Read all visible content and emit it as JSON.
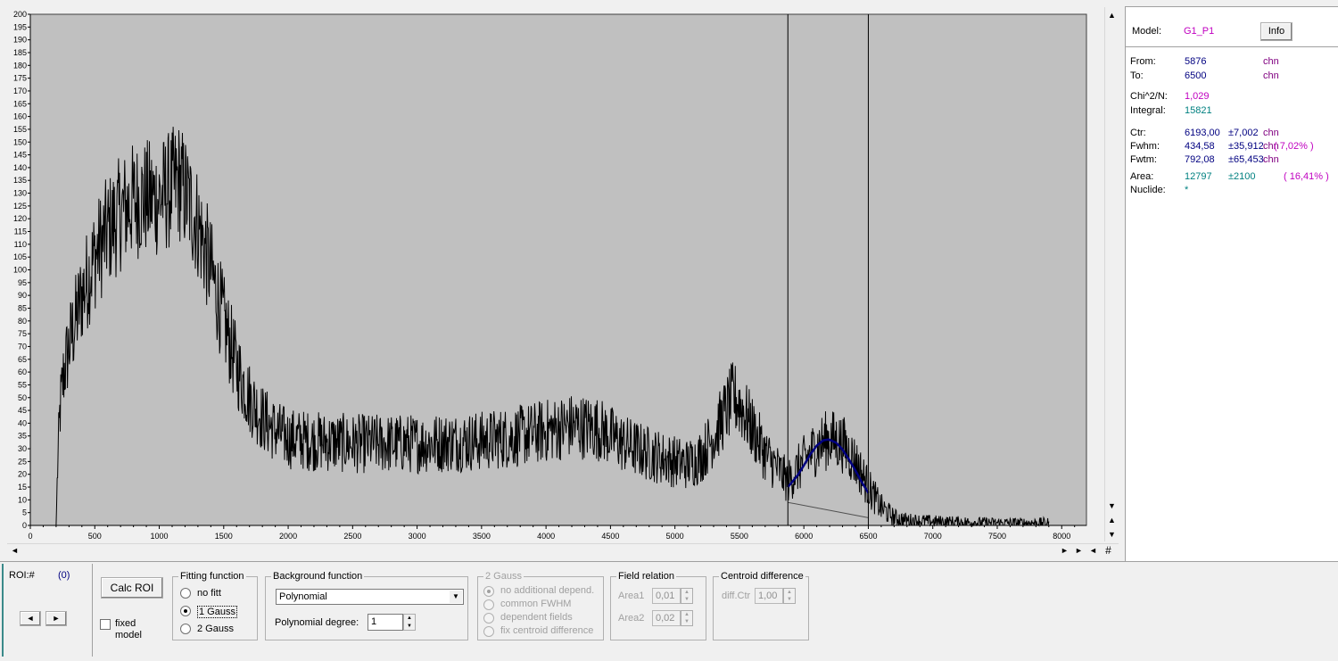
{
  "chart_data": {
    "type": "line",
    "title": "",
    "xlabel": "",
    "ylabel": "",
    "xlim": [
      0,
      8192
    ],
    "ylim": [
      0,
      200
    ],
    "x_ticks": [
      0,
      500,
      1000,
      1500,
      2000,
      2500,
      3000,
      3500,
      4000,
      4500,
      5000,
      5500,
      6000,
      6500,
      7000,
      7500,
      8000
    ],
    "y_ticks": [
      0,
      5,
      10,
      15,
      20,
      25,
      30,
      35,
      40,
      45,
      50,
      55,
      60,
      65,
      70,
      75,
      80,
      85,
      90,
      95,
      100,
      105,
      110,
      115,
      120,
      125,
      130,
      135,
      140,
      145,
      150,
      155,
      160,
      165,
      170,
      175,
      180,
      185,
      190,
      195,
      200
    ],
    "grid": false,
    "background": "#c0c0c0",
    "series": [
      {
        "color": "#000000",
        "x": [
          0,
          200,
          210,
          230,
          260,
          300,
          400,
          500,
          600,
          700,
          800,
          900,
          1000,
          1100,
          1150,
          1200,
          1300,
          1400,
          1500,
          1600,
          1700,
          1800,
          1900,
          2000,
          2200,
          2500,
          3000,
          3500,
          3800,
          4000,
          4200,
          4400,
          4500,
          4600,
          4800,
          5000,
          5100,
          5200,
          5300,
          5400,
          5450,
          5500,
          5600,
          5700,
          5800,
          5876,
          6000,
          6100,
          6200,
          6300,
          6400,
          6500,
          6600,
          6700,
          6800,
          7000,
          7500,
          7900
        ],
        "y": [
          0,
          0,
          20,
          45,
          60,
          70,
          90,
          105,
          115,
          122,
          127,
          128,
          128,
          132,
          135,
          130,
          118,
          100,
          80,
          62,
          50,
          42,
          37,
          34,
          33,
          32,
          32,
          33,
          35,
          37,
          39,
          38,
          35,
          32,
          28,
          25,
          24,
          27,
          35,
          45,
          50,
          48,
          38,
          28,
          22,
          17,
          25,
          31,
          34,
          32,
          25,
          15,
          7,
          3,
          2,
          1.5,
          1,
          1
        ]
      },
      {
        "color": "#000080",
        "x": [
          5876,
          5950,
          6000,
          6050,
          6100,
          6150,
          6193,
          6250,
          6300,
          6350,
          6400,
          6450,
          6500
        ],
        "y": [
          15,
          19.5,
          23.5,
          27.8,
          31.2,
          33.3,
          33.6,
          32.4,
          29.7,
          25.8,
          21.5,
          16.9,
          12.7
        ]
      },
      {
        "color": "#505050",
        "x": [
          5876,
          6500
        ],
        "y": [
          9,
          3
        ]
      }
    ],
    "roi_markers_x": [
      5876,
      6500
    ]
  },
  "info": {
    "model_label": "Model:",
    "model_value": "G1_P1",
    "info_button": "Info",
    "from_label": "From:",
    "from_value": "5876",
    "from_unit": "chn",
    "to_label": "To:",
    "to_value": "6500",
    "to_unit": "chn",
    "chi_label": "Chi^2/N:",
    "chi_value": "1,029",
    "integral_label": "Integral:",
    "integral_value": "15821",
    "ctr_label": "Ctr:",
    "ctr_value": "6193,00",
    "ctr_err": "±7,002",
    "ctr_unit": "chn",
    "fwhm_label": "Fwhm:",
    "fwhm_value": "434,58",
    "fwhm_err": "±35,912",
    "fwhm_unit": "chn",
    "fwhm_pct": "( 7,02% )",
    "fwtm_label": "Fwtm:",
    "fwtm_value": "792,08",
    "fwtm_err": "±65,453",
    "fwtm_unit": "chn",
    "area_label": "Area:",
    "area_value": "12797",
    "area_err": "±2100",
    "area_pct": "( 16,41% )",
    "nuclide_label": "Nuclide:",
    "nuclide_value": "*"
  },
  "bottom": {
    "roi_label": "ROI:#",
    "roi_value": "(0)",
    "prev_arrow": "◄",
    "next_arrow": "►",
    "calc_roi": "Calc ROI",
    "fixed_model": "fixed model",
    "fitting_title": "Fitting function",
    "fit_options": [
      "no fitt",
      "1 Gauss",
      "2 Gauss"
    ],
    "fit_selected": "1 Gauss",
    "background_title": "Background function",
    "background_value": "Polynomial",
    "poly_degree_label": "Polynomial degree:",
    "poly_degree_value": "1",
    "gauss2_title": "2 Gauss",
    "gauss2_options": [
      "no additional depend.",
      "common FWHM",
      "dependent fields",
      "fix centroid difference"
    ],
    "field_relation_title": "Field relation",
    "area1_label": "Area1",
    "area1_value": "0,01",
    "area2_label": "Area2",
    "area2_value": "0,02",
    "centroid_title": "Centroid difference",
    "diff_ctr_label": "diff.Ctr",
    "diff_ctr_value": "1,00"
  },
  "colors": {
    "plot_bg": "#c0c0c0",
    "fit_curve": "#000080",
    "magenta": "#c000c0",
    "teal": "#008080",
    "navy": "#000080"
  }
}
